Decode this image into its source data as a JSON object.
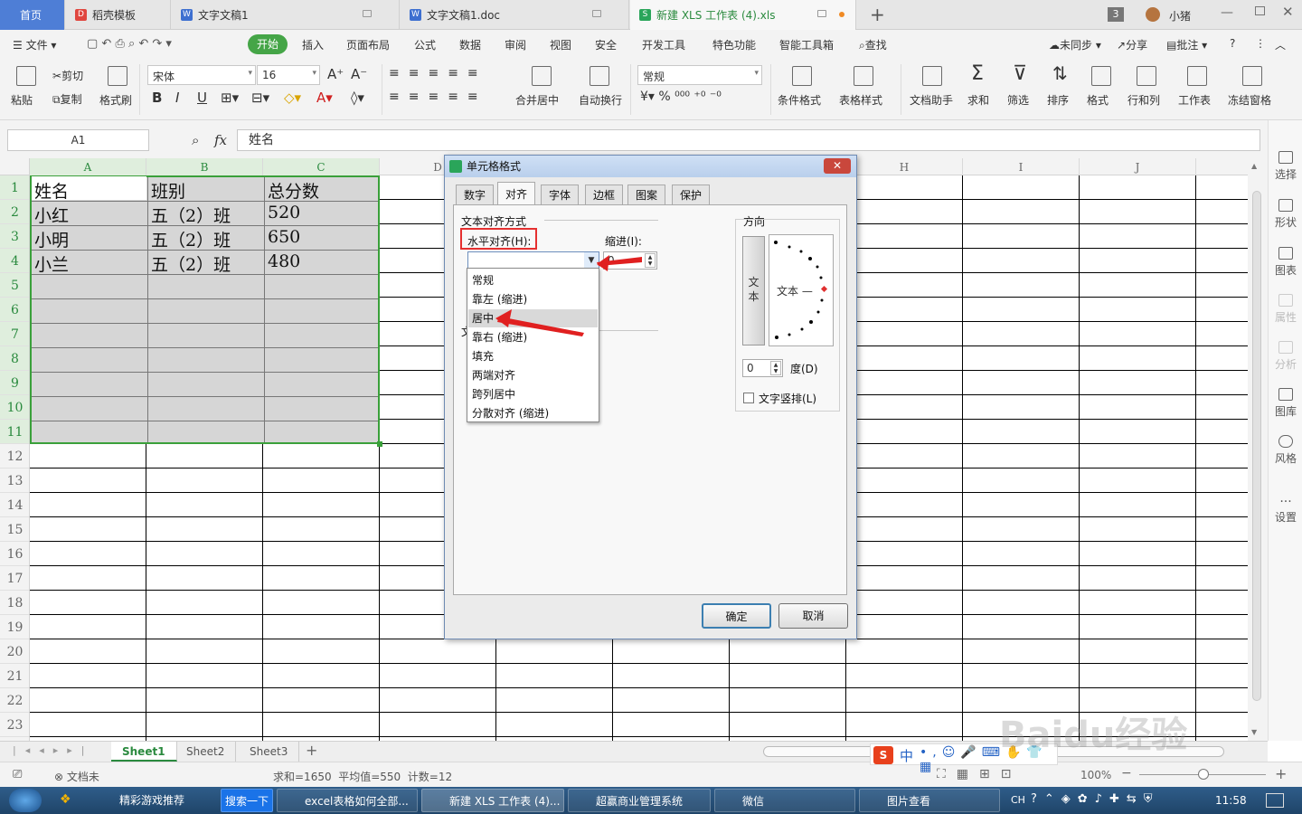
{
  "tabs": [
    {
      "label": "首页"
    },
    {
      "label": "稻壳模板"
    },
    {
      "label": "文字文稿1"
    },
    {
      "label": "文字文稿1.doc"
    },
    {
      "label": "新建 XLS 工作表 (4).xls"
    }
  ],
  "tabbar_right": {
    "window_count": "3",
    "user": "小猪"
  },
  "menu": {
    "file": "文件",
    "items": [
      "开始",
      "插入",
      "页面布局",
      "公式",
      "数据",
      "审阅",
      "视图",
      "安全",
      "开发工具",
      "特色功能",
      "智能工具箱"
    ],
    "search": "查找",
    "sync": "未同步",
    "share": "分享",
    "comment": "批注"
  },
  "ribbon": {
    "paste": "粘贴",
    "cut": "剪切",
    "copy": "复制",
    "format_painter": "格式刷",
    "font_name": "宋体",
    "font_size": "16",
    "merge": "合并居中",
    "wrap": "自动换行",
    "number_format": "常规",
    "cond_format": "条件格式",
    "table_style": "表格样式",
    "doc_helper": "文档助手",
    "sum": "求和",
    "filter": "筛选",
    "sort": "排序",
    "format": "格式",
    "rowcol": "行和列",
    "worksheet": "工作表",
    "freeze": "冻结窗格"
  },
  "formula_bar": {
    "name_box": "A1",
    "fx": "fx",
    "value": "姓名"
  },
  "columns": [
    "A",
    "B",
    "C",
    "D",
    "E",
    "F",
    "G",
    "H",
    "I",
    "J"
  ],
  "rows": [
    "1",
    "2",
    "3",
    "4",
    "5",
    "6",
    "7",
    "8",
    "9",
    "10",
    "11",
    "12",
    "13",
    "14",
    "15",
    "16",
    "17",
    "18",
    "19",
    "20",
    "21",
    "22",
    "23"
  ],
  "cells": [
    [
      "姓名",
      "班别",
      "总分数"
    ],
    [
      "小红",
      "五（2）班",
      "520"
    ],
    [
      "小明",
      "五（2）班",
      "650"
    ],
    [
      "小兰",
      "五（2）班",
      "480"
    ]
  ],
  "right_panel": [
    "选择",
    "形状",
    "图表",
    "属性",
    "分析",
    "图库",
    "风格",
    "设置"
  ],
  "sheets": [
    "Sheet1",
    "Sheet2",
    "Sheet3"
  ],
  "status": {
    "doc": "文档未",
    "stats": "求和=1650  平均值=550  计数=12",
    "zoom": "100%"
  },
  "dialog": {
    "title": "单元格格式",
    "tabs": [
      "数字",
      "对齐",
      "字体",
      "边框",
      "图案",
      "保护"
    ],
    "section": "文本对齐方式",
    "halign_label": "水平对齐(H):",
    "indent_label": "缩进(I):",
    "indent_value": "0",
    "options": [
      "常规",
      "靠左 (缩进)",
      "居中",
      "靠右 (缩进)",
      "填充",
      "两端对齐",
      "跨列居中",
      "分散对齐 (缩进)"
    ],
    "selected_option": "居中",
    "partial_label": "文",
    "direction": "方向",
    "vertical_text": "文本",
    "dial_text": "文本 —",
    "degree_value": "0",
    "degree_label": "度(D)",
    "vertical_check": "文字竖排(L)",
    "ok": "确定",
    "cancel": "取消"
  },
  "taskbar": {
    "items": [
      "精彩游戏推荐",
      "搜索一下",
      "excel表格如何全部...",
      "新建 XLS 工作表 (4)...",
      "超赢商业管理系统",
      "微信",
      "图片查看"
    ],
    "time": "11:58",
    "lang": "CH"
  },
  "ime": {
    "mode": "中"
  },
  "watermark": "Baidu经验"
}
